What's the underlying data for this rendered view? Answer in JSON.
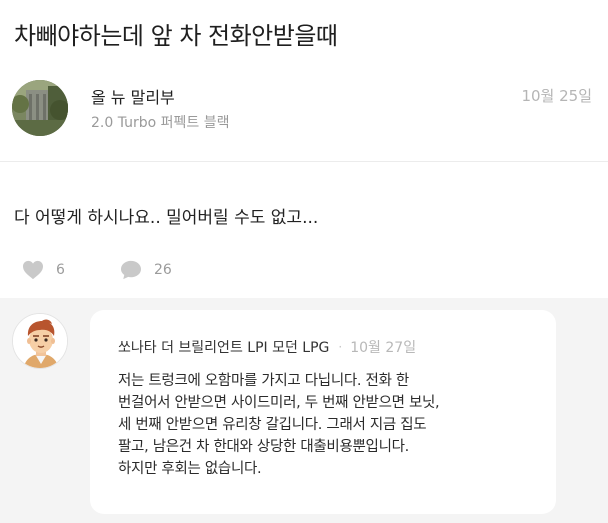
{
  "post": {
    "title": "차빼야하는데 앞 차 전화안받을때",
    "body": "다 어떻게 하시나요.. 밀어버릴 수도 없고..."
  },
  "author": {
    "name": "올 뉴 말리부",
    "car": "2.0 Turbo 퍼펙트 블랙",
    "date": "10월 25일"
  },
  "stats": {
    "likes": "6",
    "comments": "26"
  },
  "comment": {
    "car": "쏘나타 더 브릴리언트 LPI 모던 LPG",
    "separator": "·",
    "date": "10월 27일",
    "lines": [
      "저는 트렁크에 오함마를 가지고 다닙니다. 전화 한",
      "번걸어서 안받으면 사이드미러, 두 번째 안받으면 보닛,",
      "세 번째 안받으면 유리창 갈깁니다. 그래서 지금 집도",
      "팔고, 남은건 차 한대와 상당한 대출비용뿐입니다.",
      "하지만 후회는 없습니다."
    ]
  },
  "icons": {
    "like": "heart-icon",
    "comment": "speech-bubble-icon"
  },
  "colors": {
    "icon_gray": "#c9c9c9",
    "comment_bg": "#f4f4f4",
    "muted_text": "#9b9b9b"
  }
}
